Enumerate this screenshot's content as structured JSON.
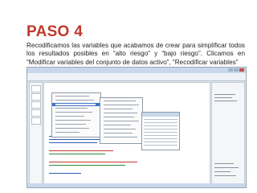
{
  "slide": {
    "title": "PASO 4",
    "body": "Recodificamos las variables que acabamos de crear para simplificar todos los resultados posibles en “alto riesgo” y “bajo riesgo”. Clicamos en “Modificar variables del conjunto de datos activo”, “Recodificar variables”"
  },
  "colors": {
    "title": "#c0392b",
    "menu_highlight": "#3d72c4",
    "code_blue": "#2f5fb3",
    "code_red": "#c0392b",
    "code_green": "#2e8b3e"
  },
  "screenshot": {
    "menu": {
      "highlighted_item_index": 2
    }
  }
}
